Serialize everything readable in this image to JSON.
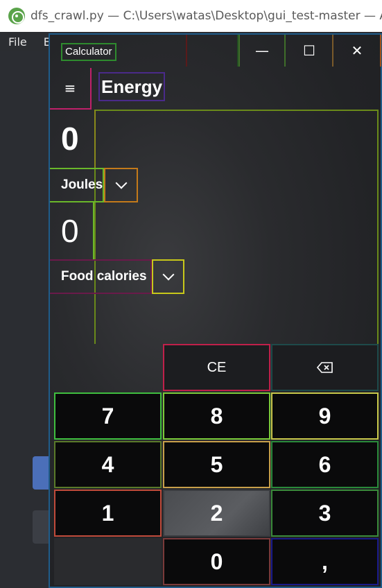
{
  "atom": {
    "title": "dfs_crawl.py — C:\\Users\\watas\\Desktop\\gui_test-master — Atom",
    "menu": [
      "File",
      "Ed"
    ]
  },
  "calculator": {
    "title": "Calculator",
    "window_buttons": {
      "minimize": "—",
      "maximize": "☐",
      "close": "✕"
    },
    "menu_icon": "≡",
    "mode": "Energy",
    "from_value": "0",
    "from_unit": "Joules",
    "to_value": "0",
    "to_unit": "Food calories",
    "keys": {
      "ce": "CE",
      "k7": "7",
      "k8": "8",
      "k9": "9",
      "k4": "4",
      "k5": "5",
      "k6": "6",
      "k1": "1",
      "k2": "2",
      "k3": "3",
      "k0": "0",
      "decimal": ","
    }
  }
}
